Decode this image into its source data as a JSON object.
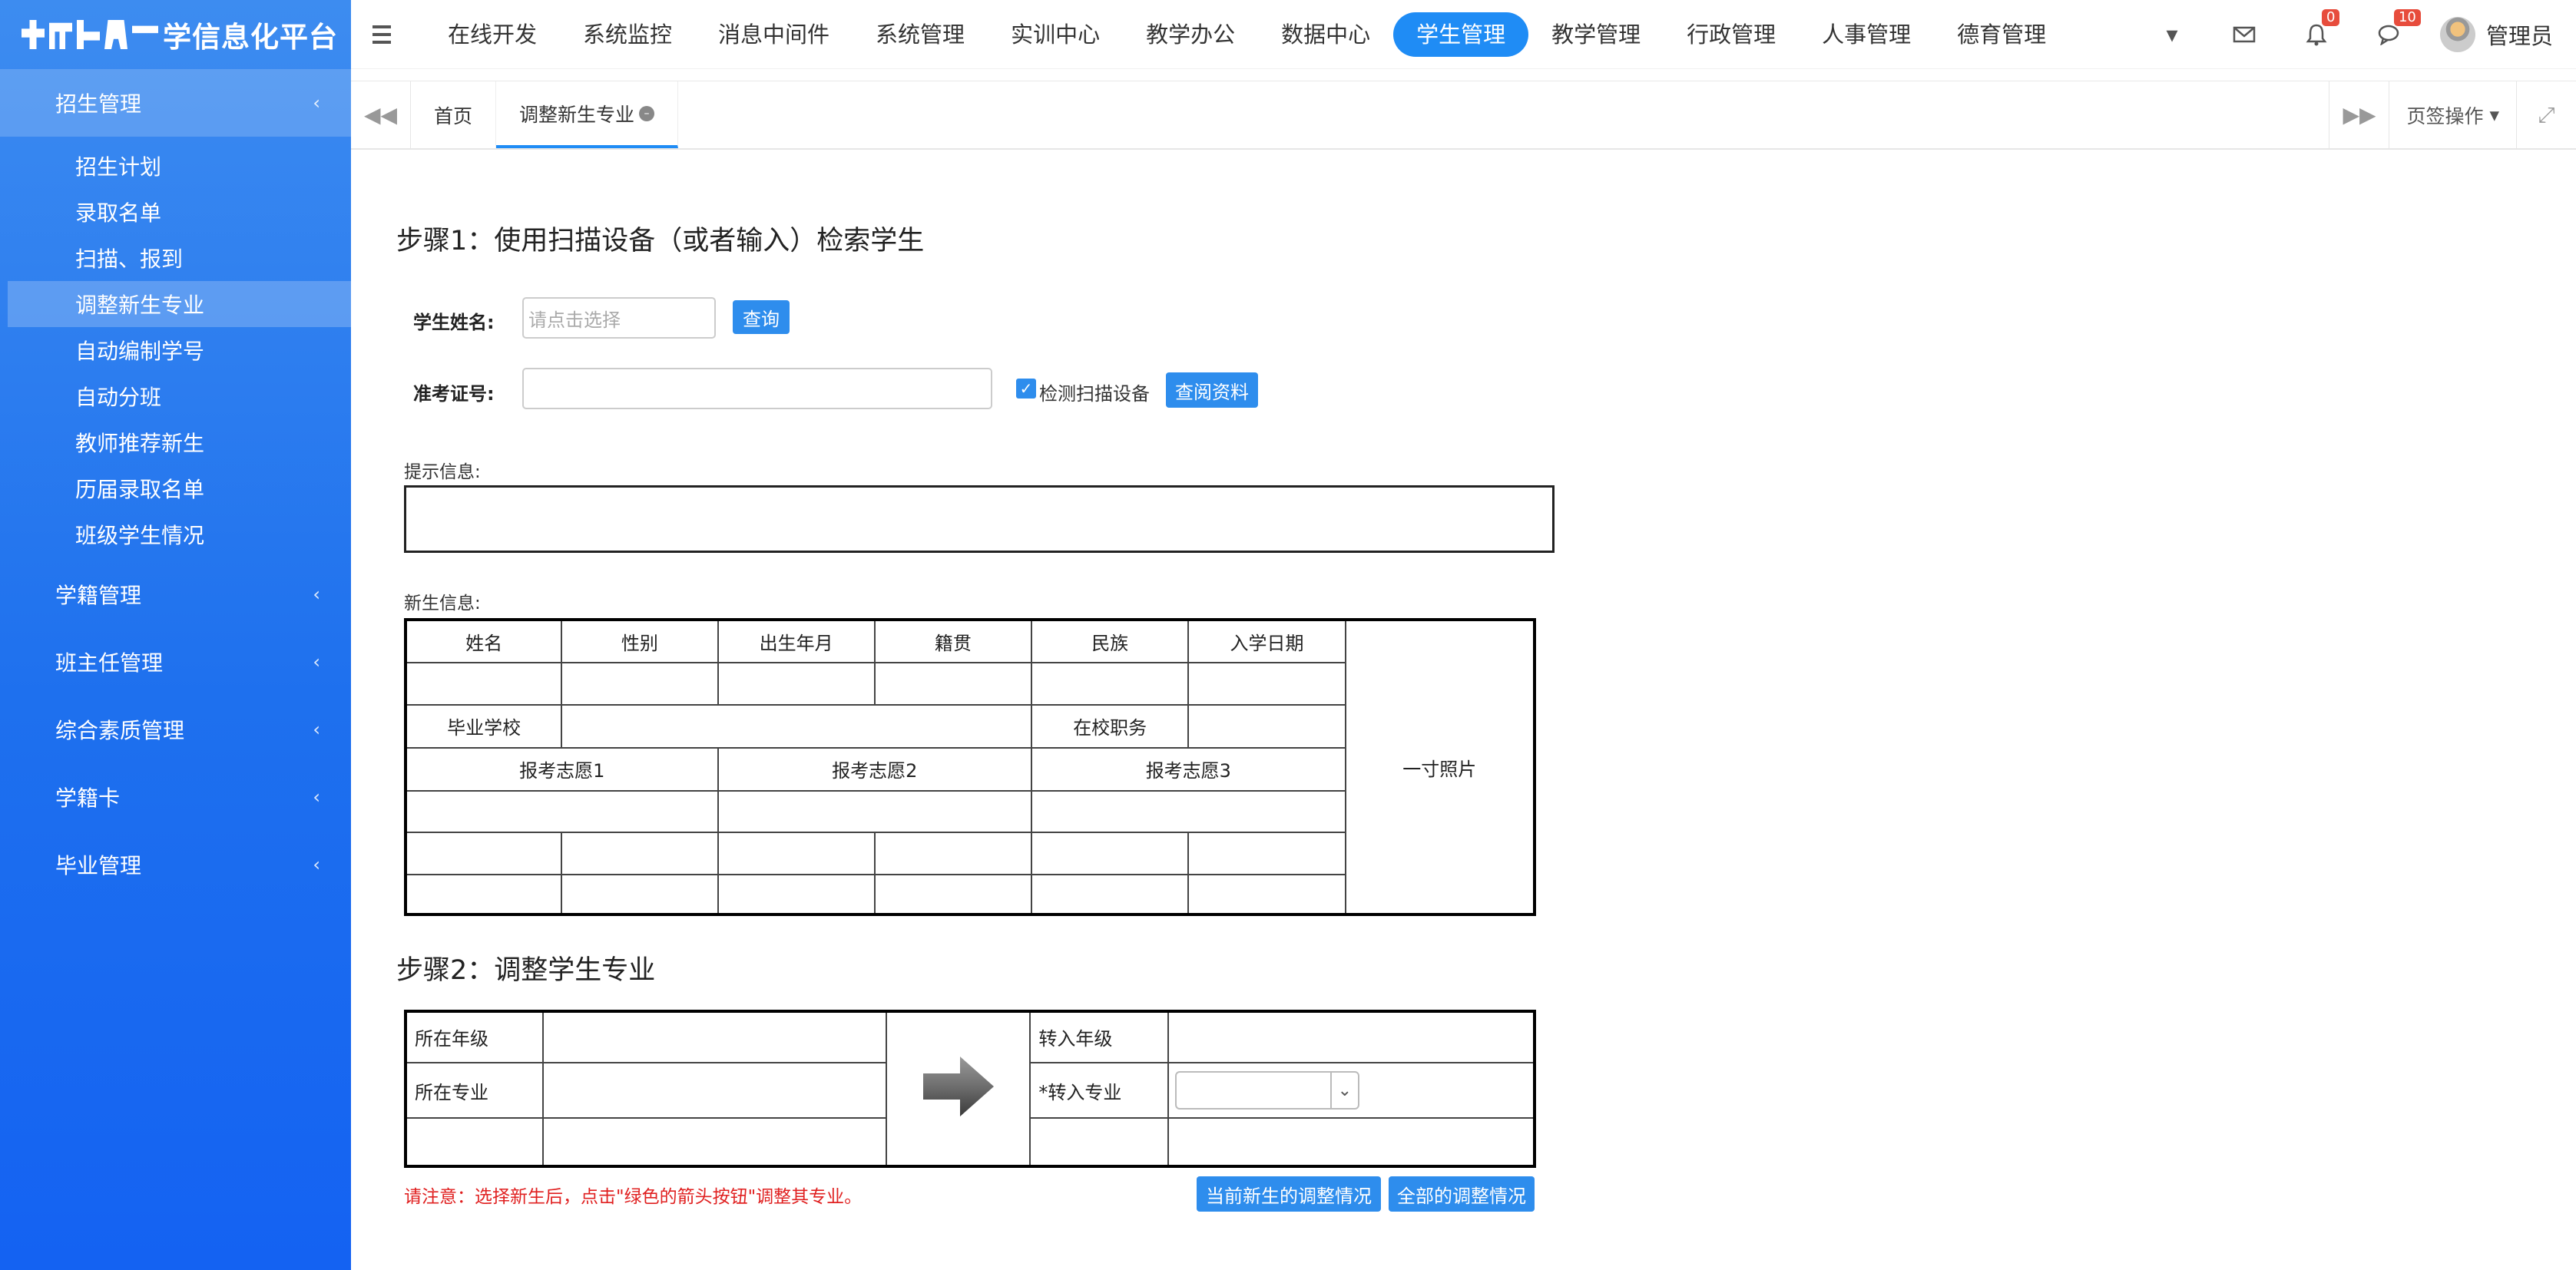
{
  "brand": {
    "title": "学信息化平台"
  },
  "sidebar": {
    "groups": [
      {
        "label": "招生管理",
        "open": true,
        "items": [
          {
            "label": "招生计划"
          },
          {
            "label": "录取名单"
          },
          {
            "label": "扫描、报到"
          },
          {
            "label": "调整新生专业",
            "active": true
          },
          {
            "label": "自动编制学号"
          },
          {
            "label": "自动分班"
          },
          {
            "label": "教师推荐新生"
          },
          {
            "label": "历届录取名单"
          },
          {
            "label": "班级学生情况"
          }
        ]
      },
      {
        "label": "学籍管理"
      },
      {
        "label": "班主任管理"
      },
      {
        "label": "综合素质管理"
      },
      {
        "label": "学籍卡"
      },
      {
        "label": "毕业管理"
      }
    ]
  },
  "topnav": {
    "items": [
      "在线开发",
      "系统监控",
      "消息中间件",
      "系统管理",
      "实训中心",
      "教学办公",
      "数据中心",
      "学生管理",
      "教学管理",
      "行政管理",
      "人事管理",
      "德育管理"
    ],
    "active": "学生管理",
    "notifications_count": "0",
    "messages_count": "10",
    "user_name": "管理员"
  },
  "tabs": {
    "items": [
      {
        "label": "首页"
      },
      {
        "label": "调整新生专业",
        "active": true
      }
    ],
    "ops_label": "页签操作"
  },
  "step1": {
    "title": "步骤1：使用扫描设备（或者输入）检索学生",
    "name_label": "学生姓名:",
    "name_placeholder": "请点击选择",
    "query_button": "查询",
    "exam_label": "准考证号:",
    "exam_value": "",
    "scan_checkbox_label": "检测扫描设备",
    "scan_checked": true,
    "view_button": "查阅资料",
    "hint_label": "提示信息:",
    "info_label": "新生信息:",
    "info_table": {
      "headers": [
        "姓名",
        "性别",
        "出生年月",
        "籍贯",
        "民族",
        "入学日期"
      ],
      "photo": "一寸照片",
      "school_label": "毕业学校",
      "duty_label": "在校职务",
      "wishes": [
        "报考志愿1",
        "报考志愿2",
        "报考志愿3"
      ]
    }
  },
  "step2": {
    "title": "步骤2：调整学生专业",
    "cur_grade": "所在年级",
    "cur_major": "所在专业",
    "to_grade": "转入年级",
    "to_major": "*转入专业",
    "note": "请注意：选择新生后，点击\"绿色的箭头按钮\"调整其专业。",
    "btn_current": "当前新生的调整情况",
    "btn_all": "全部的调整情况"
  },
  "colors": {
    "sidebar_top": "#3d8cf0",
    "sidebar_bottom": "#1462f2",
    "accent": "#1f8cf5",
    "button": "#2e8ded",
    "warning": "#e02020"
  }
}
